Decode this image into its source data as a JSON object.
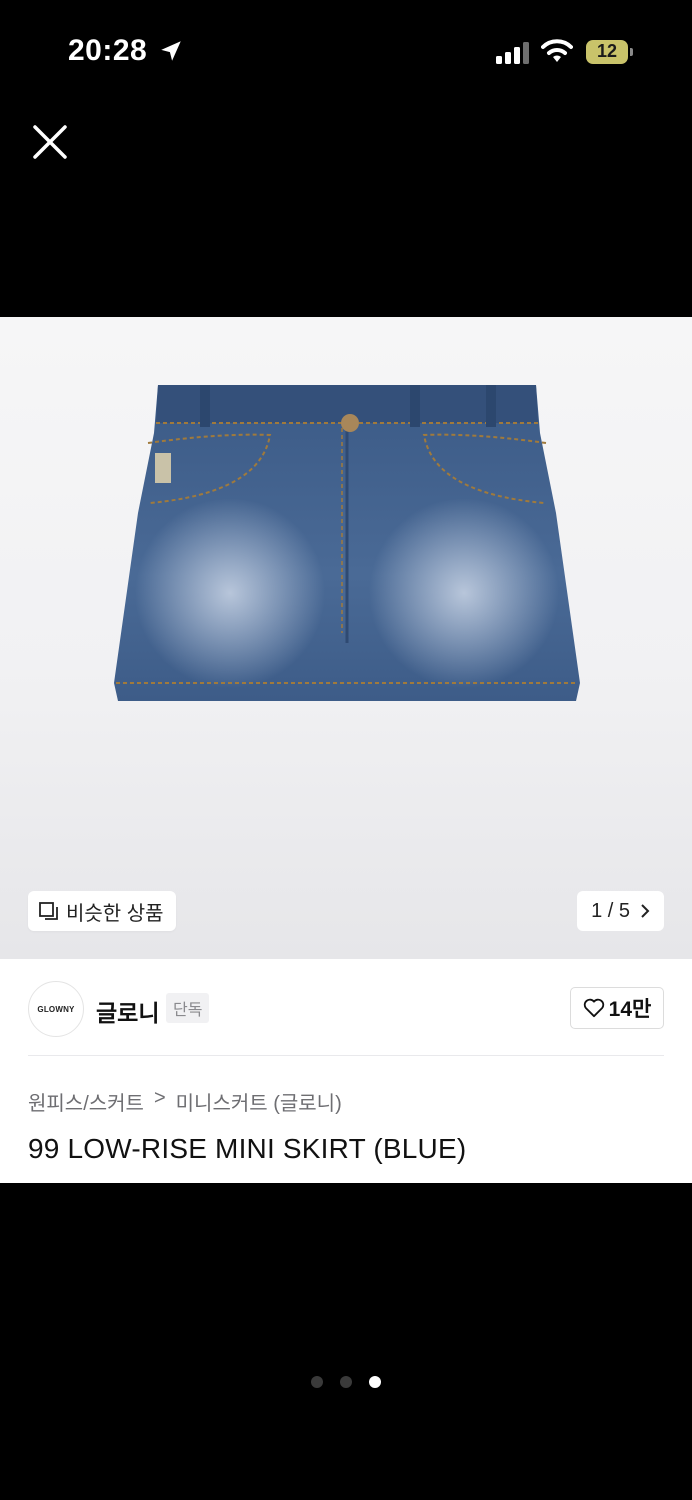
{
  "status_bar": {
    "time": "20:28",
    "battery_level": "12"
  },
  "product": {
    "image_counter": "1 / 5",
    "similar_label": "비슷한 상품",
    "brand": {
      "logo_text": "GLOWNY",
      "name": "글로니",
      "tag": "단독"
    },
    "likes": "14만",
    "breadcrumb": [
      "원피스/스커트",
      "미니스커트 (글로니)"
    ],
    "breadcrumb_separator": ">",
    "title": "99 LOW-RISE MINI SKIRT (BLUE)"
  },
  "pagination": {
    "total": 3,
    "active_index": 2
  },
  "colors": {
    "background": "#000000",
    "card": "#ffffff",
    "denim": "#3f5e8c",
    "battery": "#c9c36a"
  }
}
